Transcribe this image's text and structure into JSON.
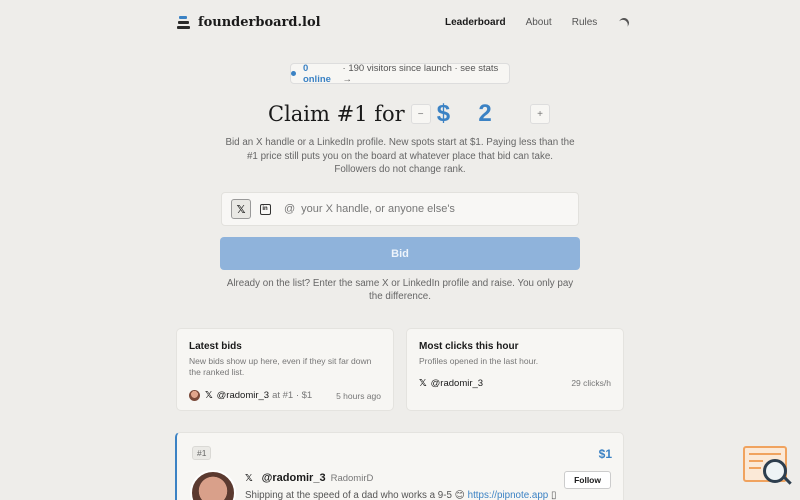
{
  "header": {
    "logo_text": "founderboard.lol",
    "nav": [
      {
        "label": "Leaderboard"
      },
      {
        "label": "About"
      },
      {
        "label": "Rules"
      }
    ]
  },
  "status": {
    "online": "0 online",
    "rest": "· 190 visitors since launch · see stats →"
  },
  "claim": {
    "title": "Claim #1 for",
    "minus": "−",
    "currency": "$",
    "amount": "2",
    "plus": "+"
  },
  "description": {
    "line1": "Bid an X handle or a LinkedIn profile. New spots start at $1. Paying less than the #1 price still puts you on the board at whatever place that bid can take.",
    "line2": "Followers do not change rank."
  },
  "input": {
    "x_label": "𝕏",
    "li_label": "in",
    "at": "@",
    "placeholder": "your X handle, or anyone else's"
  },
  "bid_button": "Bid",
  "raise_note": "Already on the list? Enter the same X or LinkedIn profile and raise. You only pay the difference.",
  "latest_bids": {
    "title": "Latest bids",
    "desc": "New bids show up here, even if they sit far down the ranked list.",
    "items": [
      {
        "x": "𝕏",
        "handle": "@radomir_3",
        "detail": "at #1 · $1",
        "time": "5 hours ago"
      }
    ]
  },
  "most_clicks": {
    "title": "Most clicks this hour",
    "desc": "Profiles opened in the last hour.",
    "items": [
      {
        "x": "𝕏",
        "handle": "@radomir_3",
        "clicks": "29 clicks/h"
      }
    ]
  },
  "entry": {
    "rank": "#1",
    "price": "$1",
    "x": "𝕏",
    "handle": "@radomir_3",
    "display_name": "RadomirD",
    "follow": "Follow",
    "bio_text": "Shipping at the speed of a dad who works a 9-5 😊 ",
    "bio_link": "https://pipnote.app",
    "bio_tail": " ▯"
  },
  "colors": {
    "accent": "#3b82c4",
    "background": "#eeedea",
    "button_disabled": "#8fb3db"
  }
}
